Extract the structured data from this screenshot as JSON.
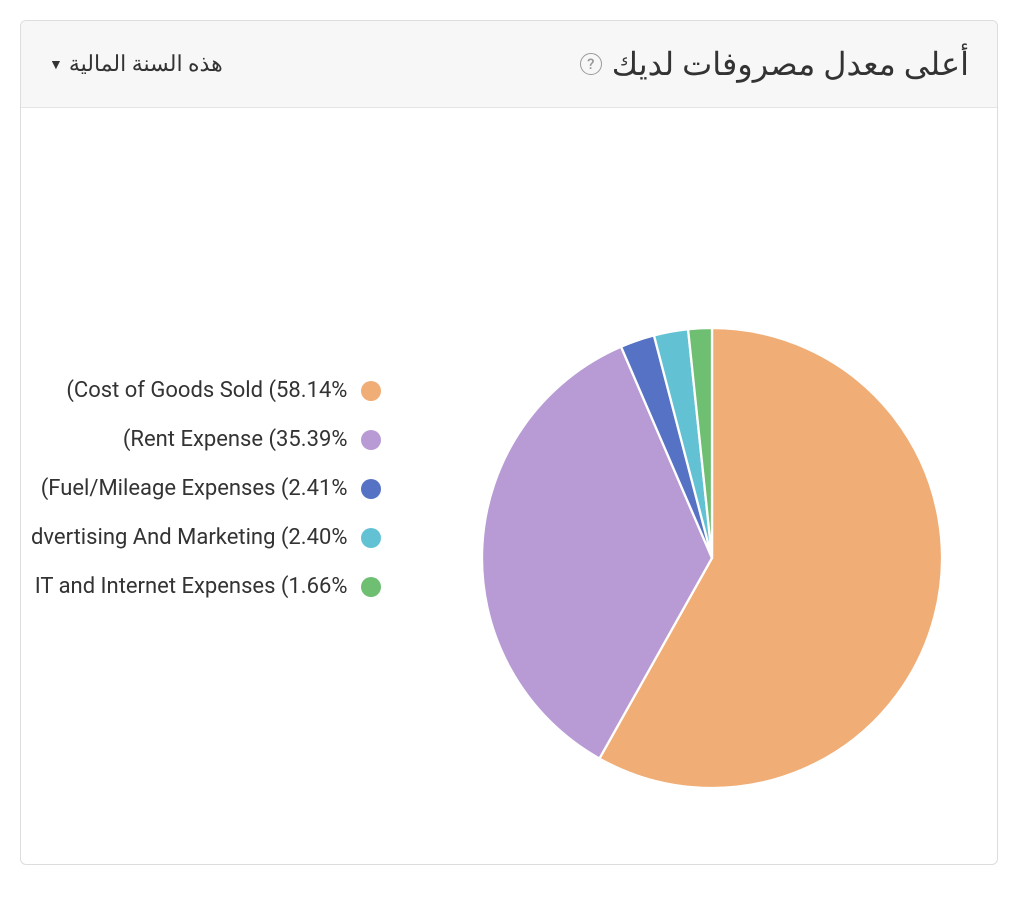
{
  "header": {
    "title": "أعلى معدل مصروفات لديك",
    "period_label": "هذه السنة المالية"
  },
  "chart_data": {
    "type": "pie",
    "title": "أعلى معدل مصروفات لديك",
    "series": [
      {
        "name": "Cost of Goods Sold",
        "value": 58.14,
        "color": "#f0ad75"
      },
      {
        "name": "Rent Expense",
        "value": 35.39,
        "color": "#b89bd4"
      },
      {
        "name": "Fuel/Mileage Expenses",
        "value": 2.41,
        "color": "#5572c5"
      },
      {
        "name": "Advertising And Marketing",
        "value": 2.4,
        "color": "#62c2d4"
      },
      {
        "name": "IT and Internet Expenses",
        "value": 1.66,
        "color": "#6fbf73"
      }
    ]
  },
  "legend_labels": [
    "(Cost of Goods Sold (58.14%",
    "(Rent Expense (35.39%",
    "(Fuel/Mileage Expenses (2.41%",
    "dvertising And Marketing (2.40%",
    "IT and Internet Expenses (1.66%"
  ]
}
